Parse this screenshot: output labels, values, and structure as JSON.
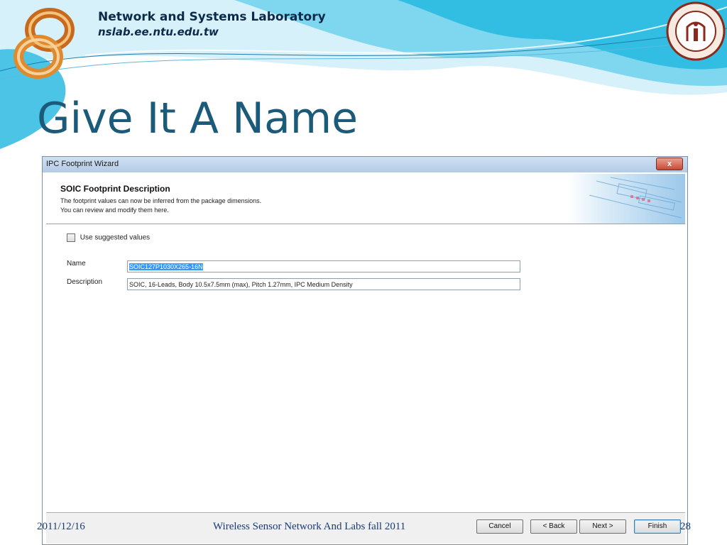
{
  "header": {
    "lab_name": "Network and Systems Laboratory",
    "lab_url": "nslab.ee.ntu.edu.tw"
  },
  "slide": {
    "title": "Give It A Name",
    "footer_date": "2011/12/16",
    "footer_center": "Wireless Sensor Network And Labs fall 2011",
    "page_number": "28"
  },
  "dialog": {
    "title": "IPC Footprint Wizard",
    "close_label": "x",
    "panel_title": "SOIC Footprint Description",
    "panel_line1": "The footprint values can now be inferred from the package dimensions.",
    "panel_line2": "You can review and modify them here.",
    "checkbox_label": "Use suggested values",
    "checkbox_checked": false,
    "name_label": "Name",
    "name_value": "SOIC127P1030X265-16N",
    "description_label": "Description",
    "description_value": "SOIC, 16-Leads, Body 10.5x7.5mm (max), Pitch 1.27mm, IPC Medium Density",
    "buttons": {
      "cancel": "Cancel",
      "back": "< Back",
      "next": "Next >",
      "finish": "Finish"
    }
  },
  "colors": {
    "title": "#1b5a78",
    "banner_light": "#cfeef8",
    "banner_mid": "#4cc4e6",
    "selection": "#3399ff"
  },
  "icons": [
    "infinity-logo-icon",
    "university-seal-icon",
    "close-icon"
  ]
}
